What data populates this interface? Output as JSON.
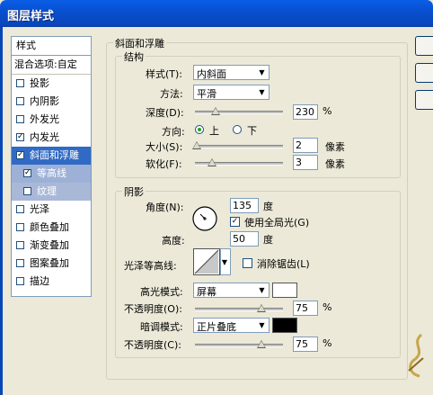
{
  "window": {
    "title": "图层样式"
  },
  "sidebar": {
    "header": "样式",
    "blend_options": "混合选项:自定",
    "items": [
      {
        "label": "投影",
        "checked": ""
      },
      {
        "label": "内阴影",
        "checked": ""
      },
      {
        "label": "外发光",
        "checked": ""
      },
      {
        "label": "内发光",
        "checked": "✓"
      },
      {
        "label": "斜面和浮雕",
        "checked": "✓"
      },
      {
        "label": "等高线",
        "checked": "✓"
      },
      {
        "label": "纹理",
        "checked": ""
      },
      {
        "label": "光泽",
        "checked": ""
      },
      {
        "label": "颜色叠加",
        "checked": ""
      },
      {
        "label": "渐变叠加",
        "checked": ""
      },
      {
        "label": "图案叠加",
        "checked": ""
      },
      {
        "label": "描边",
        "checked": ""
      }
    ]
  },
  "bevel": {
    "group_title": "斜面和浮雕",
    "structure_title": "结构",
    "style_label": "样式(T):",
    "style_value": "内斜面",
    "technique_label": "方法:",
    "technique_value": "平滑",
    "depth_label": "深度(D):",
    "depth_value": "230",
    "depth_unit": "%",
    "depth_fraction": 0.23,
    "direction_label": "方向:",
    "direction_up": "上",
    "direction_down": "下",
    "size_label": "大小(S):",
    "size_value": "2",
    "size_unit": "像素",
    "soften_label": "软化(F):",
    "soften_value": "3",
    "soften_unit": "像素"
  },
  "shading": {
    "title": "阴影",
    "angle_label": "角度(N):",
    "angle_value": "135",
    "angle_unit": "度",
    "global_light_label": "使用全局光(G)",
    "global_light_checked": "✓",
    "altitude_label": "高度:",
    "altitude_value": "50",
    "altitude_unit": "度",
    "gloss_contour_label": "光泽等高线:",
    "anti_alias_label": "消除锯齿(L)",
    "highlight_mode_label": "高光模式:",
    "highlight_mode_value": "屏幕",
    "highlight_color": "#ffffff",
    "highlight_opacity_label": "不透明度(O):",
    "highlight_opacity_value": "75",
    "highlight_opacity_unit": "%",
    "shadow_mode_label": "暗调模式:",
    "shadow_mode_value": "正片叠底",
    "shadow_color": "#000000",
    "shadow_opacity_label": "不透明度(C):",
    "shadow_opacity_value": "75",
    "shadow_opacity_unit": "%"
  }
}
